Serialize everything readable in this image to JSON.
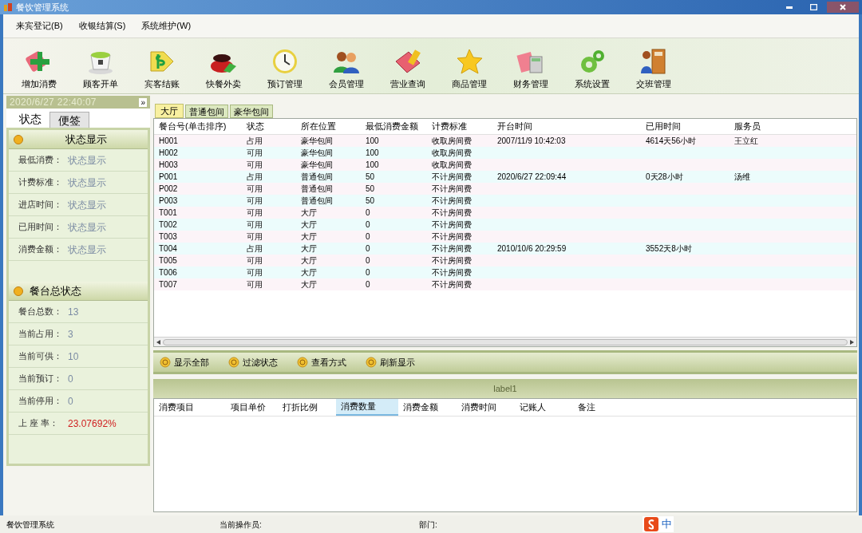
{
  "window": {
    "title": "餐饮管理系统"
  },
  "menu": [
    "来宾登记(B)",
    "收银结算(S)",
    "系统维护(W)"
  ],
  "toolbar": [
    "增加消费",
    "顾客开单",
    "宾客结账",
    "快餐外卖",
    "预订管理",
    "会员管理",
    "营业查询",
    "商品管理",
    "财务管理",
    "系统设置",
    "交班管理"
  ],
  "sidebar": {
    "datetime": "2020/6/27  22:40:07",
    "collapse": "»",
    "tabs": [
      {
        "label": "状态",
        "selected": true
      },
      {
        "label": "便签",
        "selected": false
      }
    ],
    "sections": [
      {
        "title": "状态显示",
        "fields": [
          {
            "label": "最低消费：",
            "value": "状态显示"
          },
          {
            "label": "计费标准：",
            "value": "状态显示"
          },
          {
            "label": "进店时间：",
            "value": "状态显示"
          },
          {
            "label": "已用时间：",
            "value": "状态显示"
          },
          {
            "label": "消费金额：",
            "value": "状态显示"
          }
        ]
      },
      {
        "title": "餐台总状态",
        "fields": [
          {
            "label": "餐台总数：",
            "value": "13"
          },
          {
            "label": "当前占用：",
            "value": "3"
          },
          {
            "label": "当前可供：",
            "value": "10"
          },
          {
            "label": "当前预订：",
            "value": "0"
          },
          {
            "label": "当前停用：",
            "value": "0"
          },
          {
            "label": "上 座 率：",
            "value": "23.07692%",
            "highlight": true
          }
        ]
      }
    ]
  },
  "area_tabs": [
    {
      "label": "大厅",
      "selected": true
    },
    {
      "label": "普通包间",
      "selected": false
    },
    {
      "label": "豪华包间",
      "selected": false
    }
  ],
  "table": {
    "columns": [
      "餐台号(单击排序)",
      "状态",
      "所在位置",
      "最低消费金额",
      "计费标准",
      "开台时间",
      "已用时间",
      "服务员"
    ],
    "rows": [
      [
        "H001",
        "占用",
        "豪华包间",
        "100",
        "收取房间费",
        "2007/11/9 10:42:03",
        "4614天56小时",
        "王立红"
      ],
      [
        "H002",
        "可用",
        "豪华包间",
        "100",
        "收取房间费",
        "",
        "",
        ""
      ],
      [
        "H003",
        "可用",
        "豪华包间",
        "100",
        "收取房间费",
        "",
        "",
        ""
      ],
      [
        "P001",
        "占用",
        "普通包间",
        "50",
        "不计房间费",
        "2020/6/27 22:09:44",
        "0天28小时",
        "汤维"
      ],
      [
        "P002",
        "可用",
        "普通包间",
        "50",
        "不计房间费",
        "",
        "",
        ""
      ],
      [
        "P003",
        "可用",
        "普通包间",
        "50",
        "不计房间费",
        "",
        "",
        ""
      ],
      [
        "T001",
        "可用",
        "大厅",
        "0",
        "不计房间费",
        "",
        "",
        ""
      ],
      [
        "T002",
        "可用",
        "大厅",
        "0",
        "不计房间费",
        "",
        "",
        ""
      ],
      [
        "T003",
        "可用",
        "大厅",
        "0",
        "不计房间费",
        "",
        "",
        ""
      ],
      [
        "T004",
        "占用",
        "大厅",
        "0",
        "不计房间费",
        "2010/10/6 20:29:59",
        "3552天8小时",
        ""
      ],
      [
        "T005",
        "可用",
        "大厅",
        "0",
        "不计房间费",
        "",
        "",
        ""
      ],
      [
        "T006",
        "可用",
        "大厅",
        "0",
        "不计房间费",
        "",
        "",
        ""
      ],
      [
        "T007",
        "可用",
        "大厅",
        "0",
        "不计房间费",
        "",
        "",
        ""
      ]
    ]
  },
  "actions": [
    "显示全部",
    "过滤状态",
    "查看方式",
    "刷新显示"
  ],
  "detail": {
    "caption": "label1",
    "columns": [
      {
        "label": "消费项目",
        "selected": false
      },
      {
        "label": "项目单价",
        "selected": false
      },
      {
        "label": "打折比例",
        "selected": false
      },
      {
        "label": "消费数量",
        "selected": true
      },
      {
        "label": "消费金额",
        "selected": false
      },
      {
        "label": "消费时间",
        "selected": false
      },
      {
        "label": "记账人",
        "selected": false
      },
      {
        "label": "备注",
        "selected": false
      }
    ]
  },
  "status_bar": {
    "app": "餐饮管理系统",
    "operator": "当前操作员:",
    "department": "部门:",
    "ime": "中"
  }
}
